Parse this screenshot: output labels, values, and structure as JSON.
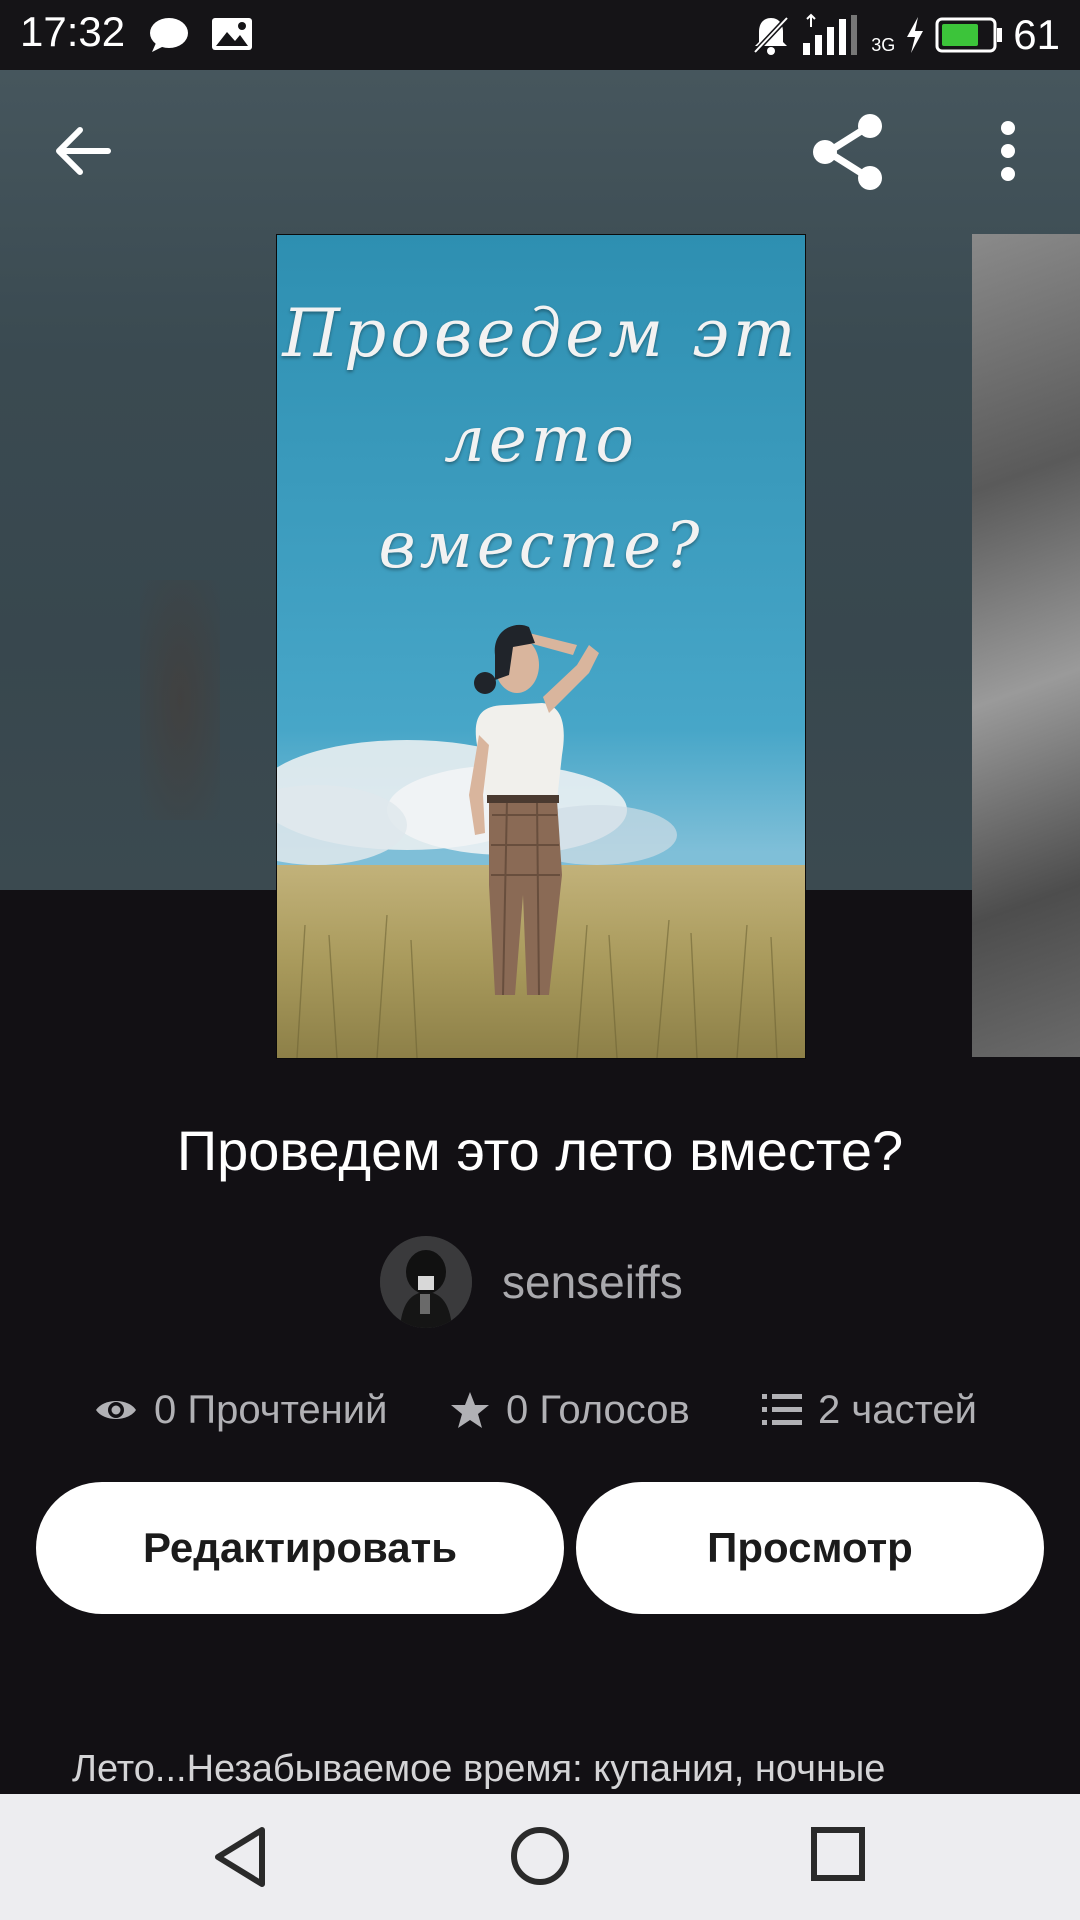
{
  "status_bar": {
    "time": "17:32",
    "network": "3G",
    "battery_level": "61",
    "icons": [
      "message-icon",
      "photo-icon",
      "muted-bell-icon",
      "signal-icon",
      "charging-icon",
      "battery-icon"
    ]
  },
  "toolbar": {
    "icons": [
      "back-arrow-icon",
      "share-icon",
      "more-vert-icon"
    ]
  },
  "cover": {
    "line1": "Проведем эт",
    "line2": "лето",
    "line3": "вместе?"
  },
  "story": {
    "title": "Проведем это лето вместе?",
    "author": "senseiffs",
    "description": "Лето...Незабываемое время: купания, ночные"
  },
  "stats": {
    "reads": "0 Прочтений",
    "votes": "0 Голосов",
    "parts": "2 частей"
  },
  "actions": {
    "edit_label": "Редактировать",
    "view_label": "Просмотр"
  },
  "colors": {
    "background": "#121014",
    "button_bg": "#ffffff",
    "nav_bar_bg": "#ededf0"
  }
}
